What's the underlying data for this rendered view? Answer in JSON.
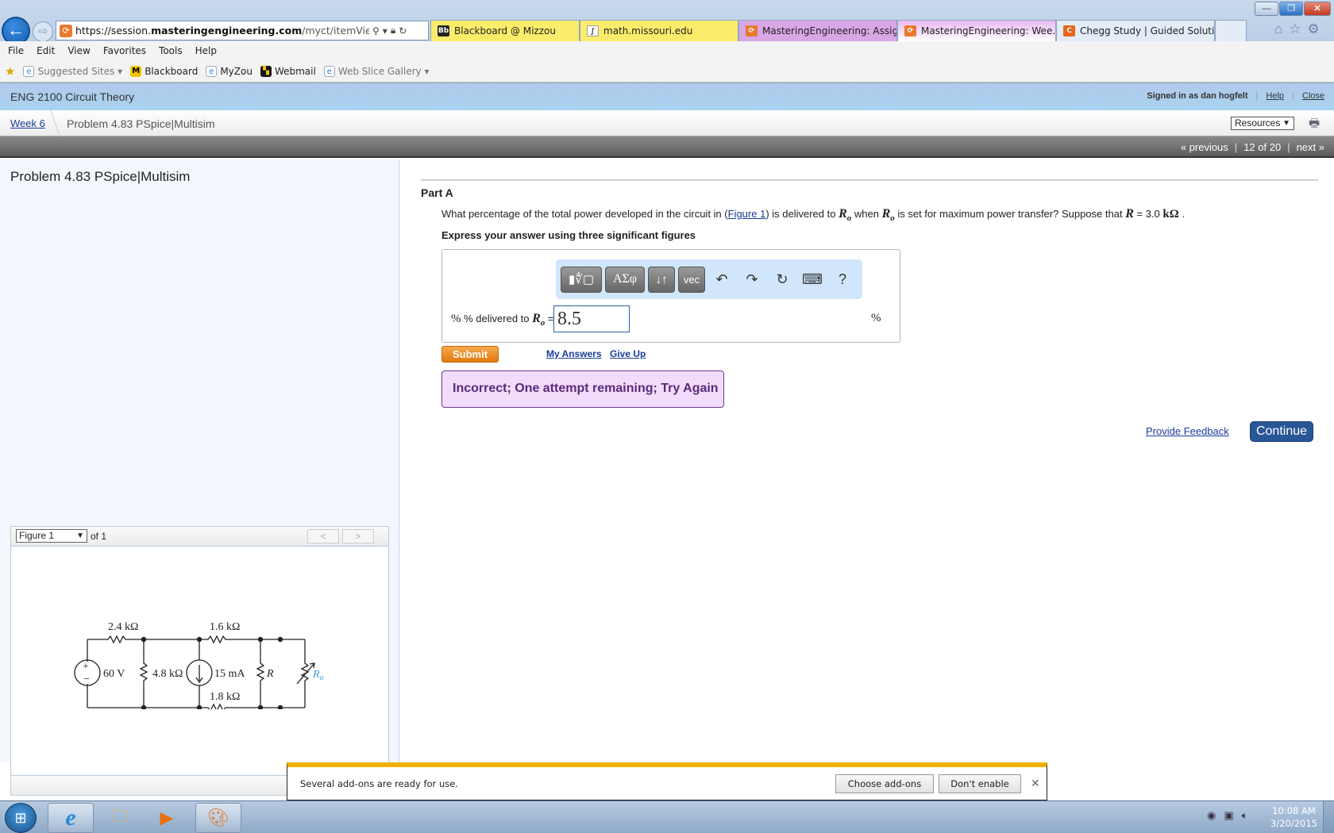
{
  "browser": {
    "address": {
      "scheme": "https://session.",
      "domain": "masteringengineering.com",
      "path": "/myct/itemView?assignn"
    },
    "tabs": [
      {
        "label": "Blackboard @ Mizzou",
        "icon": "blackboard-icon",
        "icon_text": "Bb",
        "color": "#fbec6b"
      },
      {
        "label": "math.missouri.edu",
        "icon": "integral-icon",
        "icon_text": "∫",
        "color": "#fbec6b"
      },
      {
        "label": "MasteringEngineering: Assign...",
        "icon": "mastering-icon",
        "icon_text": "⟳",
        "color": "#d9a6e6"
      },
      {
        "label": "MasteringEngineering: Wee...",
        "icon": "mastering-icon",
        "icon_text": "⟳",
        "color": "#e8b9f0",
        "active": true
      },
      {
        "label": "Chegg Study | Guided Solutio...",
        "icon": "chegg-icon",
        "icon_text": "C",
        "color": "#e3ecf7"
      }
    ],
    "menu": [
      "File",
      "Edit",
      "View",
      "Favorites",
      "Tools",
      "Help"
    ],
    "favorites": [
      {
        "label": "Suggested Sites ▾",
        "icon": "ie-page-icon",
        "dim": true
      },
      {
        "label": "Blackboard",
        "icon": "mizzou-icon"
      },
      {
        "label": "MyZou",
        "icon": "ie-page-icon"
      },
      {
        "label": "Webmail",
        "icon": "mizzou-webmail-icon"
      },
      {
        "label": "Web Slice Gallery ▾",
        "icon": "ie-page-icon",
        "dim": true
      }
    ]
  },
  "header": {
    "course_title": "ENG 2100 Circuit Theory",
    "signed_in": "Signed in as dan hogfelt",
    "help": "Help",
    "close": "Close",
    "breadcrumb_week": "Week 6",
    "breadcrumb_problem": "Problem 4.83 PSpice|Multisim",
    "resources": "Resources",
    "nav_previous": "« previous",
    "nav_position": "12 of 20",
    "nav_next": "next »"
  },
  "left": {
    "title": "Problem 4.83 PSpice|Multisim",
    "figure_select": "Figure 1",
    "figure_of": "of 1",
    "circuit_labels": {
      "r1": "2.4 kΩ",
      "r2": "1.6 kΩ",
      "vs": "60 V",
      "r3": "4.8 kΩ",
      "is": "15 mA",
      "r": "R",
      "ro": "R",
      "ro_sub": "o",
      "r4": "1.8 kΩ"
    }
  },
  "main": {
    "part": "Part A",
    "question_pre": "What percentage of the total power developed in the circuit in (",
    "figure_link": "Figure 1",
    "question_mid1": ") is delivered to ",
    "question_mid2": " when ",
    "question_mid3": " is set for maximum power transfer? Suppose that ",
    "question_r_value": " = 3.0 ",
    "question_unit": "kΩ",
    "question_end": " .",
    "instruction": "Express your answer using three significant figures",
    "toolbar": {
      "greek": "ΑΣφ",
      "subscript": "↓↑",
      "vec": "vec",
      "undo": "↶",
      "redo": "↷",
      "reset": "↻",
      "keyboard": "⌨",
      "help": "?"
    },
    "answer_label": "% delivered to ",
    "answer_value": "8.5",
    "unit": "%",
    "submit": "Submit",
    "my_answers": "My Answers",
    "give_up": "Give Up",
    "feedback": "Incorrect; One attempt remaining; Try Again",
    "provide_feedback": "Provide Feedback",
    "continue": "Continue"
  },
  "notification": {
    "text": "Several add-ons are ready for use.",
    "choose": "Choose add-ons",
    "dont_enable": "Don't enable"
  },
  "taskbar": {
    "time": "10:08 AM",
    "date": "3/20/2015"
  }
}
